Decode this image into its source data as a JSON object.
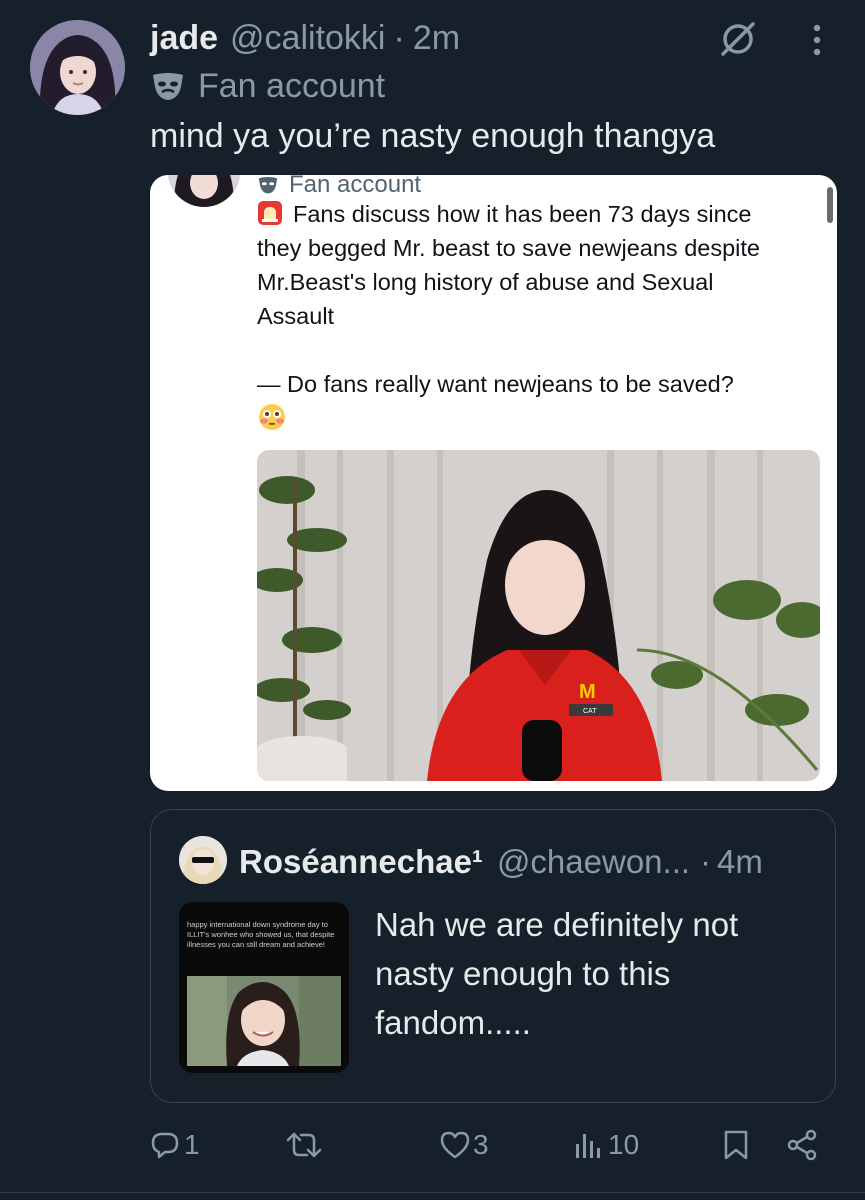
{
  "tweet": {
    "display_name": "jade",
    "handle": "@calitokki",
    "separator": "·",
    "time": "2m",
    "account_label": "Fan account",
    "text": "mind ya you’re nasty enough thangya"
  },
  "screenshot": {
    "account_label": "Fan account",
    "lines": [
      "Fans discuss how it has been 73 days since",
      "they begged Mr. beast to save newjeans despite",
      "Mr.Beast's long history of abuse and Sexual",
      "Assault",
      "",
      "— Do fans really want newjeans to be saved?"
    ],
    "shirt_logo": "M",
    "name_tag": "CAT"
  },
  "quote": {
    "display_name": "Roséannechae¹",
    "handle": "@chaewon...",
    "separator": "·",
    "time": "4m",
    "text": "Nah we are definitely not nasty enough to this fandom.....",
    "thumb_caption": "happy international down syndrome day to ILLIT's wonhee who showed us, that despite illnesses you can still dream and achieve!"
  },
  "actions": {
    "replies": "1",
    "reposts": "",
    "likes": "3",
    "views": "10"
  },
  "icons": [
    "grok-icon",
    "more-icon",
    "mask-icon",
    "siren-emoji",
    "flushed-emoji",
    "reply-icon",
    "repost-icon",
    "like-icon",
    "views-icon",
    "bookmark-icon",
    "share-icon"
  ],
  "colors": {
    "background": "#15202b",
    "primary_text": "#e7e9ea",
    "secondary_text": "#8b98a5",
    "border": "#38444d"
  }
}
